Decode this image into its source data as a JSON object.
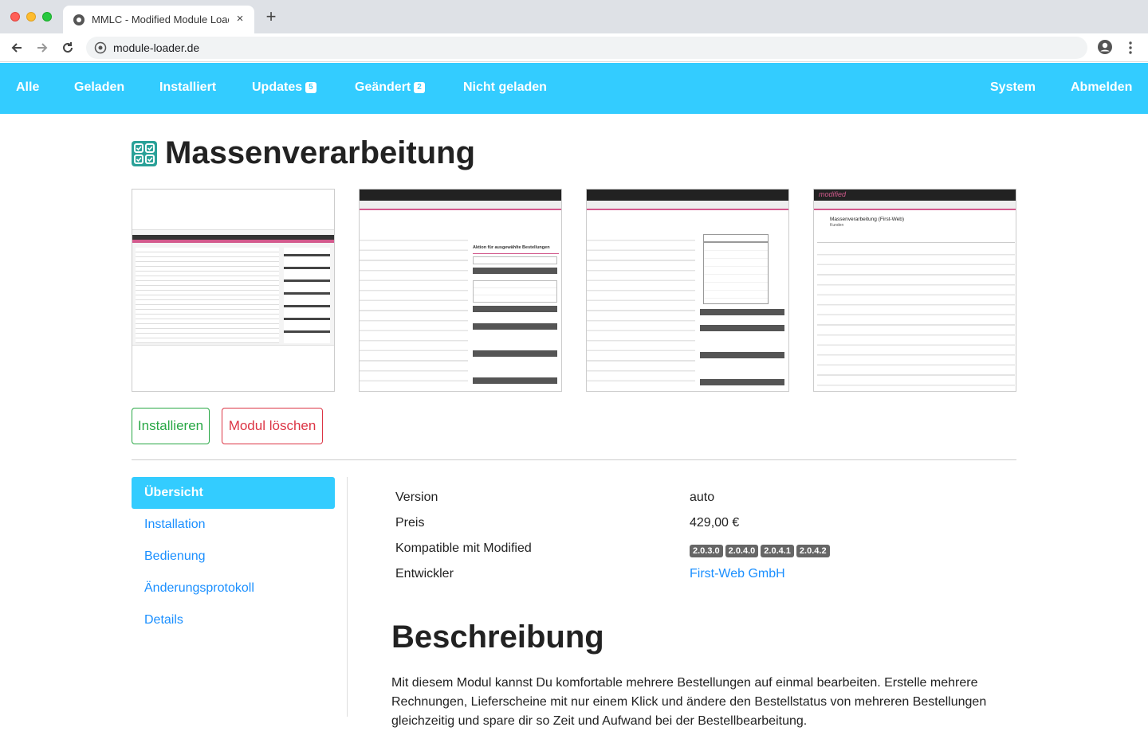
{
  "browser": {
    "tab_title": "MMLC - Modified Module Loader",
    "url": "module-loader.de",
    "new_tab_label": "+",
    "close_label": "×"
  },
  "nav": {
    "items": [
      {
        "label": "Alle"
      },
      {
        "label": "Geladen"
      },
      {
        "label": "Installiert"
      },
      {
        "label": "Updates",
        "badge": "5"
      },
      {
        "label": "Geändert",
        "badge": "2"
      },
      {
        "label": "Nicht geladen"
      }
    ],
    "right": [
      {
        "label": "System"
      },
      {
        "label": "Abmelden"
      }
    ],
    "bg_color": "#33ccff"
  },
  "module": {
    "title": "Massenverarbeitung",
    "icon": "checklist-icon",
    "install_label": "Installieren",
    "delete_label": "Modul löschen"
  },
  "screenshots": {
    "shot4_brand": "modified",
    "shot4_heading": "Massenverarbeitung (First-Web)",
    "shot4_sub": "Kunden",
    "shot2_panel_title": "Aktion für ausgewählte Bestellungen"
  },
  "sidebar": {
    "items": [
      {
        "label": "Übersicht",
        "active": true
      },
      {
        "label": "Installation"
      },
      {
        "label": "Bedienung"
      },
      {
        "label": "Änderungsprotokoll"
      },
      {
        "label": "Details"
      }
    ]
  },
  "info": {
    "version_label": "Version",
    "version_value": "auto",
    "price_label": "Preis",
    "price_value": "429,00 €",
    "compat_label": "Kompatible mit Modified",
    "compat_versions": [
      "2.0.3.0",
      "2.0.4.0",
      "2.0.4.1",
      "2.0.4.2"
    ],
    "dev_label": "Entwickler",
    "dev_value": "First-Web GmbH"
  },
  "description": {
    "title": "Beschreibung",
    "text": "Mit diesem Modul kannst Du komfortable mehrere Bestellungen auf einmal bearbeiten. Erstelle mehrere Rechnungen, Lieferscheine mit nur einem Klick und ändere den Bestellstatus von mehreren Bestellungen gleichzeitig und spare dir so Zeit und Aufwand bei der Bestellbearbeitung."
  }
}
